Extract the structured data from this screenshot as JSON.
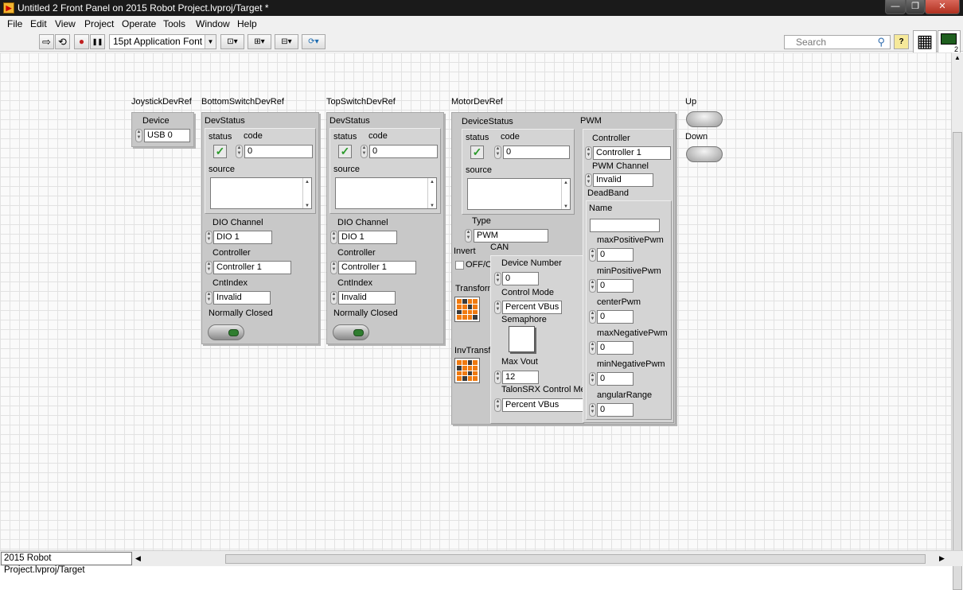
{
  "window": {
    "title": "Untitled 2 Front Panel on 2015 Robot Project.lvproj/Target *",
    "icon": "labview-vi-icon",
    "minimize": "—",
    "restore": "❐",
    "close": "✕"
  },
  "menu": [
    "File",
    "Edit",
    "View",
    "Project",
    "Operate",
    "Tools",
    "Window",
    "Help"
  ],
  "toolbar": {
    "run": "⇨",
    "run_continuous": "⟲",
    "abort": "●",
    "pause": "❚❚",
    "font": "15pt Application Font",
    "align": "⊡▾",
    "distribute": "⊞▾",
    "resize": "⊟▾",
    "reorder": "⟳▾",
    "search_placeholder": "Search",
    "search_icon": "⚲",
    "help_icon": "?",
    "connector_icon": "▦",
    "vi_icon_label": "2"
  },
  "controls": {
    "joystick": {
      "label": "JoystickDevRef",
      "device_label": "Device",
      "device": "USB 0"
    },
    "bottom_switch": {
      "label": "BottomSwitchDevRef",
      "devstatus": "DevStatus",
      "status": "status",
      "code": "code",
      "code_value": "0",
      "source": "source",
      "dio_label": "DIO Channel",
      "dio": "DIO 1",
      "controller_label": "Controller",
      "controller": "Controller 1",
      "cntindex_label": "CntIndex",
      "cntindex": "Invalid",
      "nc_label": "Normally Closed"
    },
    "top_switch": {
      "label": "TopSwitchDevRef",
      "devstatus": "DevStatus",
      "status": "status",
      "code": "code",
      "code_value": "0",
      "source": "source",
      "dio_label": "DIO Channel",
      "dio": "DIO 1",
      "controller_label": "Controller",
      "controller": "Controller 1",
      "cntindex_label": "CntIndex",
      "cntindex": "Invalid",
      "nc_label": "Normally Closed"
    },
    "motor": {
      "label": "MotorDevRef",
      "devicestatus": "DeviceStatus",
      "status": "status",
      "code": "code",
      "code_value": "0",
      "source": "source",
      "type_label": "Type",
      "type": "PWM",
      "invert_label": "Invert",
      "invert_value": "OFF/O",
      "transform_label": "Transform",
      "invtransform_label": "InvTransf",
      "can": {
        "label": "CAN",
        "devnum_label": "Device Number",
        "devnum": "0",
        "mode_label": "Control Mode",
        "mode": "Percent VBus",
        "semaphore_label": "Semaphore",
        "maxvout_label": "Max Vout",
        "maxvout": "12",
        "talon_label": "TalonSRX Control Me",
        "talon": "Percent VBus"
      },
      "pwm": {
        "label": "PWM",
        "controller_label": "Controller",
        "controller": "Controller 1",
        "channel_label": "PWM Channel",
        "channel": "Invalid",
        "deadband_label": "DeadBand",
        "name_label": "Name",
        "name": "",
        "maxpos_label": "maxPositivePwm",
        "maxpos": "0",
        "minpos_label": "minPositivePwm",
        "minpos": "0",
        "center_label": "centerPwm",
        "center": "0",
        "maxneg_label": "maxNegativePwm",
        "maxneg": "0",
        "minneg_label": "minNegativePwm",
        "minneg": "0",
        "angular_label": "angularRange",
        "angular": "0"
      }
    },
    "up_label": "Up",
    "down_label": "Down"
  },
  "statusbar": {
    "path": "2015 Robot Project.lvproj/Target"
  }
}
